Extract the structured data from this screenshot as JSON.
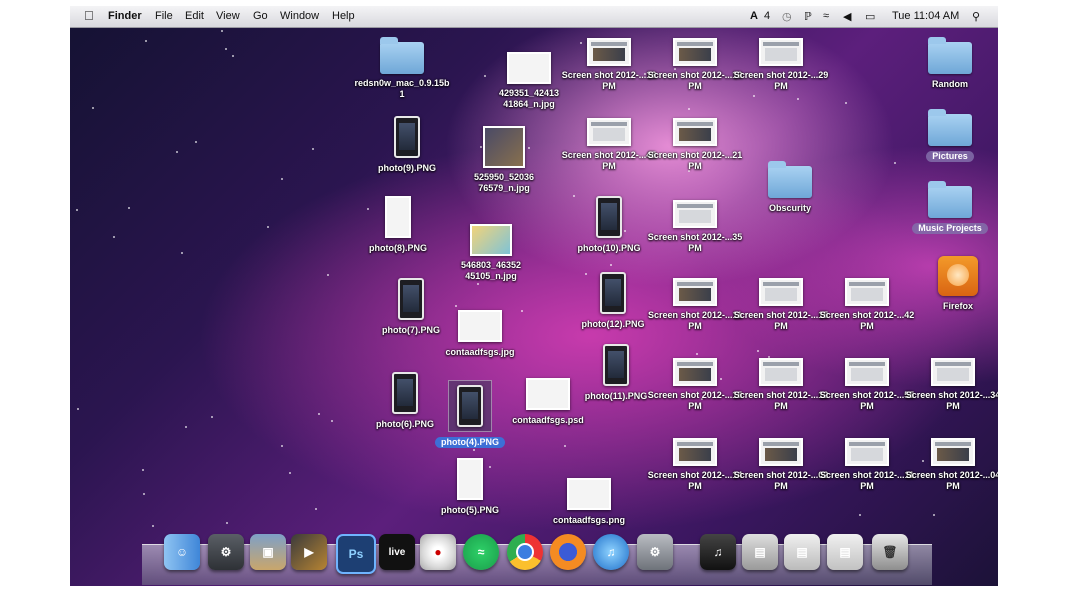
{
  "menubar": {
    "app": "Finder",
    "items": [
      "File",
      "Edit",
      "View",
      "Go",
      "Window",
      "Help"
    ],
    "status_badge": "4",
    "clock": "Tue 11:04 AM"
  },
  "desktop": {
    "redsn0w": "redsn0w_mac_0.9.15b1",
    "jpg_429": "429351_42413 41864_n.jpg",
    "photo9": "photo(9).PNG",
    "jpg_525": "525950_52036 76579_n.jpg",
    "photo8": "photo(8).PNG",
    "jpg_546": "546803_46352 45105_n.jpg",
    "photo7": "photo(7).PNG",
    "contaad_jpg": "contaadfsgs.jpg",
    "photo6": "photo(6).PNG",
    "photo4": "photo(4).PNG",
    "contaad_psd": "contaadfsgs.psd",
    "photo5": "photo(5).PNG",
    "contaad_png": "contaadfsgs.png",
    "photo10": "photo(10).PNG",
    "photo12": "photo(12).PNG",
    "photo11": "photo(11).PNG",
    "ss_16": "Screen shot 2012-...16 PM",
    "ss_19": "Screen shot 2012-...19 PM",
    "ss_29": "Screen shot 2012-...29 PM",
    "ss_45": "Screen shot 2012-...45 PM",
    "ss_21": "Screen shot 2012-...21 PM",
    "ss_35": "Screen shot 2012-...35 PM",
    "ss_11a": "Screen shot 2012-...11 PM",
    "ss_15a": "Screen shot 2012-...15 PM",
    "ss_42": "Screen shot 2012-...42 PM",
    "ss_15b": "Screen shot 2012-...15 PM",
    "ss_12": "Screen shot 2012-...12 PM",
    "ss_55": "Screen shot 2012-...55 PM",
    "ss_34": "Screen shot 2012-...34 PM",
    "ss_14": "Screen shot 2012-...14 PM",
    "ss_02": "Screen shot 2012-...02 PM",
    "ss_11b": "Screen shot 2012-...11 PM",
    "ss_04": "Screen shot 2012-...04 PM",
    "obscurity": "Obscurity",
    "random": "Random",
    "pictures": "Pictures",
    "music_projects": "Music Projects",
    "firefox": "Firefox"
  },
  "dock": {
    "photoshop": "Ps",
    "live": "live"
  },
  "colors": {
    "selection": "#3d6fd6",
    "folder": "#6fa7d7"
  }
}
